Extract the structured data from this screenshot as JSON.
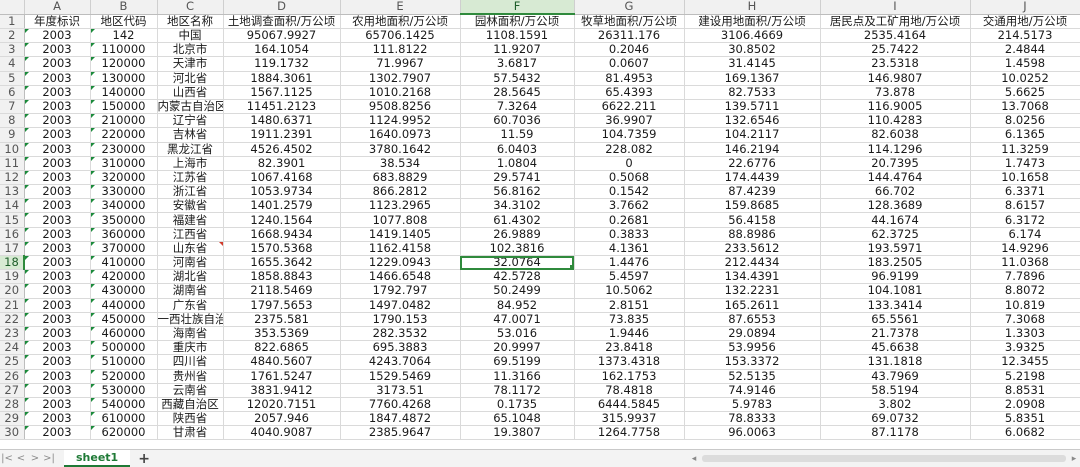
{
  "columns": [
    "A",
    "B",
    "C",
    "D",
    "E",
    "F",
    "G",
    "H",
    "I",
    "J"
  ],
  "selected_column": "F",
  "selected_row": 18,
  "selected_cell": {
    "row": 18,
    "col": "F"
  },
  "header_row": [
    "年度标识",
    "地区代码",
    "地区名称",
    "土地调查面积/万公顷",
    "农用地面积/万公顷",
    "园林面积/万公顷",
    "牧草地面积/万公顷",
    "建设用地面积/万公顷",
    "居民点及工矿用地/万公顷",
    "交通用地/万公顷"
  ],
  "rows": [
    [
      "2003",
      "142",
      "中国",
      "95067.9927",
      "65706.1425",
      "1108.1591",
      "26311.176",
      "3106.4669",
      "2535.4164",
      "214.5173"
    ],
    [
      "2003",
      "110000",
      "北京市",
      "164.1054",
      "111.8122",
      "11.9207",
      "0.2046",
      "30.8502",
      "25.7422",
      "2.4844"
    ],
    [
      "2003",
      "120000",
      "天津市",
      "119.1732",
      "71.9967",
      "3.6817",
      "0.0607",
      "31.4145",
      "23.5318",
      "1.4598"
    ],
    [
      "2003",
      "130000",
      "河北省",
      "1884.3061",
      "1302.7907",
      "57.5432",
      "81.4953",
      "169.1367",
      "146.9807",
      "10.0252"
    ],
    [
      "2003",
      "140000",
      "山西省",
      "1567.1125",
      "1010.2168",
      "28.5645",
      "65.4393",
      "82.7533",
      "73.878",
      "5.6625"
    ],
    [
      "2003",
      "150000",
      "内蒙古自治区",
      "11451.2123",
      "9508.8256",
      "7.3264",
      "6622.211",
      "139.5711",
      "116.9005",
      "13.7068"
    ],
    [
      "2003",
      "210000",
      "辽宁省",
      "1480.6371",
      "1124.9952",
      "60.7036",
      "36.9907",
      "132.6546",
      "110.4283",
      "8.0256"
    ],
    [
      "2003",
      "220000",
      "吉林省",
      "1911.2391",
      "1640.0973",
      "11.59",
      "104.7359",
      "104.2117",
      "82.6038",
      "6.1365"
    ],
    [
      "2003",
      "230000",
      "黑龙江省",
      "4526.4502",
      "3780.1642",
      "6.0403",
      "228.082",
      "146.2194",
      "114.1296",
      "11.3259"
    ],
    [
      "2003",
      "310000",
      "上海市",
      "82.3901",
      "38.534",
      "1.0804",
      "0",
      "22.6776",
      "20.7395",
      "1.7473"
    ],
    [
      "2003",
      "320000",
      "江苏省",
      "1067.4168",
      "683.8829",
      "29.5741",
      "0.5068",
      "174.4439",
      "144.4764",
      "10.1658"
    ],
    [
      "2003",
      "330000",
      "浙江省",
      "1053.9734",
      "866.2812",
      "56.8162",
      "0.1542",
      "87.4239",
      "66.702",
      "6.3371"
    ],
    [
      "2003",
      "340000",
      "安徽省",
      "1401.2579",
      "1123.2965",
      "34.3102",
      "3.7662",
      "159.8685",
      "128.3689",
      "8.6157"
    ],
    [
      "2003",
      "350000",
      "福建省",
      "1240.1564",
      "1077.808",
      "61.4302",
      "0.2681",
      "56.4158",
      "44.1674",
      "6.3172"
    ],
    [
      "2003",
      "360000",
      "江西省",
      "1668.9434",
      "1419.1405",
      "26.9889",
      "0.3833",
      "88.8986",
      "62.3725",
      "6.174"
    ],
    [
      "2003",
      "370000",
      "山东省",
      "1570.5368",
      "1162.4158",
      "102.3816",
      "4.1361",
      "233.5612",
      "193.5971",
      "14.9296"
    ],
    [
      "2003",
      "410000",
      "河南省",
      "1655.3642",
      "1229.0943",
      "32.0764",
      "1.4476",
      "212.4434",
      "183.2505",
      "11.0368"
    ],
    [
      "2003",
      "420000",
      "湖北省",
      "1858.8843",
      "1466.6548",
      "42.5728",
      "5.4597",
      "134.4391",
      "96.9199",
      "7.7896"
    ],
    [
      "2003",
      "430000",
      "湖南省",
      "2118.5469",
      "1792.797",
      "50.2499",
      "10.5062",
      "132.2231",
      "104.1081",
      "8.8072"
    ],
    [
      "2003",
      "440000",
      "广东省",
      "1797.5653",
      "1497.0482",
      "84.952",
      "2.8151",
      "165.2611",
      "133.3414",
      "10.819"
    ],
    [
      "2003",
      "450000",
      "一西壮族自治[",
      "2375.581",
      "1790.153",
      "47.0071",
      "73.835",
      "87.6553",
      "65.5561",
      "7.3068"
    ],
    [
      "2003",
      "460000",
      "海南省",
      "353.5369",
      "282.3532",
      "53.016",
      "1.9446",
      "29.0894",
      "21.7378",
      "1.3303"
    ],
    [
      "2003",
      "500000",
      "重庆市",
      "822.6865",
      "695.3883",
      "20.9997",
      "23.8418",
      "53.9956",
      "45.6638",
      "3.9325"
    ],
    [
      "2003",
      "510000",
      "四川省",
      "4840.5607",
      "4243.7064",
      "69.5199",
      "1373.4318",
      "153.3372",
      "131.1818",
      "12.3455"
    ],
    [
      "2003",
      "520000",
      "贵州省",
      "1761.5247",
      "1529.5469",
      "11.3166",
      "162.1753",
      "52.5135",
      "43.7969",
      "5.2198"
    ],
    [
      "2003",
      "530000",
      "云南省",
      "3831.9412",
      "3173.51",
      "78.1172",
      "78.4818",
      "74.9146",
      "58.5194",
      "8.8531"
    ],
    [
      "2003",
      "540000",
      "西藏自治区",
      "12020.7151",
      "7760.4268",
      "0.1735",
      "6444.5845",
      "5.9783",
      "3.802",
      "2.0908"
    ],
    [
      "2003",
      "610000",
      "陕西省",
      "2057.946",
      "1847.4872",
      "65.1048",
      "315.9937",
      "78.8333",
      "69.0732",
      "5.8351"
    ],
    [
      "2003",
      "620000",
      "甘肃省",
      "4040.9087",
      "2385.9647",
      "19.3807",
      "1264.7758",
      "96.0063",
      "87.1178",
      "6.0682"
    ]
  ],
  "sheet_tab": "sheet1",
  "add_tab_label": "+",
  "nav_icons": [
    "|<",
    "<",
    ">",
    ">|"
  ]
}
